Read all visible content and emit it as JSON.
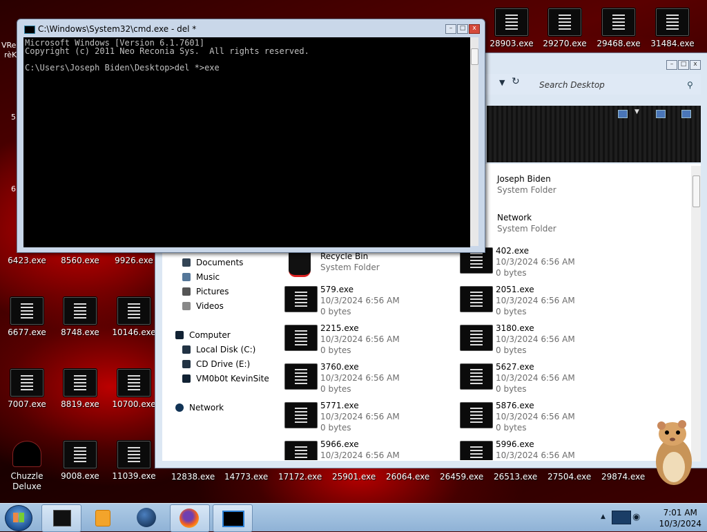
{
  "desktop": {
    "top_row": [
      "28903.exe",
      "29270.exe",
      "29468.exe",
      "31484.exe"
    ],
    "left_icons": [
      {
        "label": "6423.exe"
      },
      {
        "label": "8560.exe"
      },
      {
        "label": "9926.exe"
      },
      {
        "label": "6677.exe"
      },
      {
        "label": "8748.exe"
      },
      {
        "label": "10146.exe"
      },
      {
        "label": "7007.exe"
      },
      {
        "label": "8819.exe"
      },
      {
        "label": "10700.exe"
      },
      {
        "label": "9008.exe"
      },
      {
        "label": "11039.exe"
      }
    ],
    "partial_labels": [
      "VRe",
      "rèKi",
      "5",
      "6"
    ],
    "chuzzle": "Chuzzle Deluxe",
    "bottom_row": [
      "12838.exe",
      "14773.exe",
      "17172.exe",
      "25901.exe",
      "26064.exe",
      "26459.exe",
      "26513.exe",
      "27504.exe",
      "29874.exe"
    ]
  },
  "cmd": {
    "title": "C:\\Windows\\System32\\cmd.exe - del  *",
    "lines": [
      "Microsoft Windows [Version 6.1.7601]",
      "Copyright (c) 2011 Neo Reconia Sys.  All rights reserved.",
      "",
      "C:\\Users\\Joseph Biden\\Desktop>del *>exe"
    ]
  },
  "explorer": {
    "search_placeholder": "Search Desktop",
    "nav": {
      "documents": "Documents",
      "music": "Music",
      "pictures": "Pictures",
      "videos": "Videos",
      "computer": "Computer",
      "local_disk": "Local Disk (C:)",
      "cd_drive": "CD Drive (E:)",
      "vm": "VM0b0t KevinSite",
      "network": "Network"
    },
    "top_items": [
      {
        "name": "Joseph Biden",
        "type": "System Folder"
      },
      {
        "name": "Network",
        "type": "System Folder"
      }
    ],
    "recycle": {
      "name": "Recycle Bin",
      "type": "System Folder"
    },
    "col1": [
      {
        "name": "579.exe",
        "date": "10/3/2024 6:56 AM",
        "size": "0 bytes"
      },
      {
        "name": "2215.exe",
        "date": "10/3/2024 6:56 AM",
        "size": "0 bytes"
      },
      {
        "name": "3760.exe",
        "date": "10/3/2024 6:56 AM",
        "size": "0 bytes"
      },
      {
        "name": "5771.exe",
        "date": "10/3/2024 6:56 AM",
        "size": "0 bytes"
      },
      {
        "name": "5966.exe",
        "date": "10/3/2024 6:56 AM",
        "size": ""
      }
    ],
    "col2": [
      {
        "name": "402.exe",
        "date": "10/3/2024 6:56 AM",
        "size": "0 bytes"
      },
      {
        "name": "2051.exe",
        "date": "10/3/2024 6:56 AM",
        "size": "0 bytes"
      },
      {
        "name": "3180.exe",
        "date": "10/3/2024 6:56 AM",
        "size": "0 bytes"
      },
      {
        "name": "5627.exe",
        "date": "10/3/2024 6:56 AM",
        "size": "0 bytes"
      },
      {
        "name": "5876.exe",
        "date": "10/3/2024 6:56 AM",
        "size": "0 bytes"
      },
      {
        "name": "5996.exe",
        "date": "10/3/2024 6:56 AM",
        "size": ""
      }
    ]
  },
  "taskbar": {
    "time": "7:01 AM",
    "date": "10/3/2024"
  }
}
